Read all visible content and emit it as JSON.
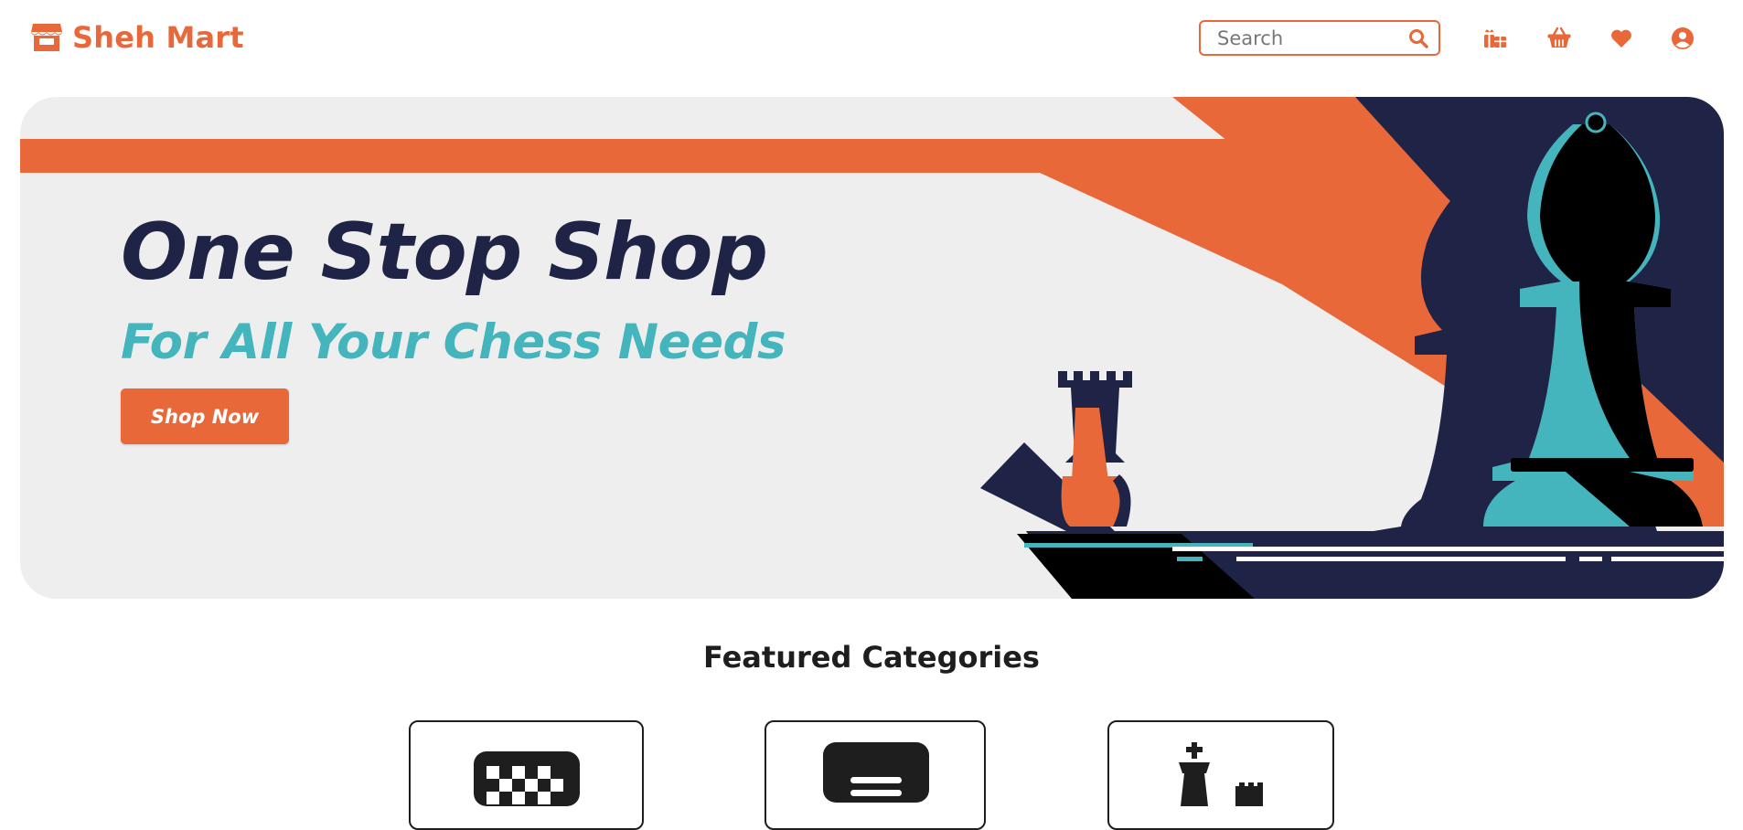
{
  "brand": {
    "name": "Sheh Mart",
    "icon": "store-icon",
    "color": "#e8683a"
  },
  "search": {
    "placeholder": "Search",
    "value": "",
    "icon": "search-icon"
  },
  "nav": {
    "icons": [
      {
        "name": "gifts-icon"
      },
      {
        "name": "basket-icon"
      },
      {
        "name": "heart-icon"
      },
      {
        "name": "user-account-icon"
      }
    ]
  },
  "hero": {
    "title": "One Stop Shop",
    "subtitle": "For All Your Chess Needs",
    "button_label": "Shop Now",
    "colors": {
      "navy": "#1f2447",
      "orange": "#e8683a",
      "teal": "#45b5bd",
      "background": "#eeeeee"
    }
  },
  "featured": {
    "title": "Featured Categories",
    "categories": [
      {
        "icon": "chessboard-icon"
      },
      {
        "icon": "menu-list-icon"
      },
      {
        "icon": "chess-pieces-icon"
      }
    ]
  }
}
